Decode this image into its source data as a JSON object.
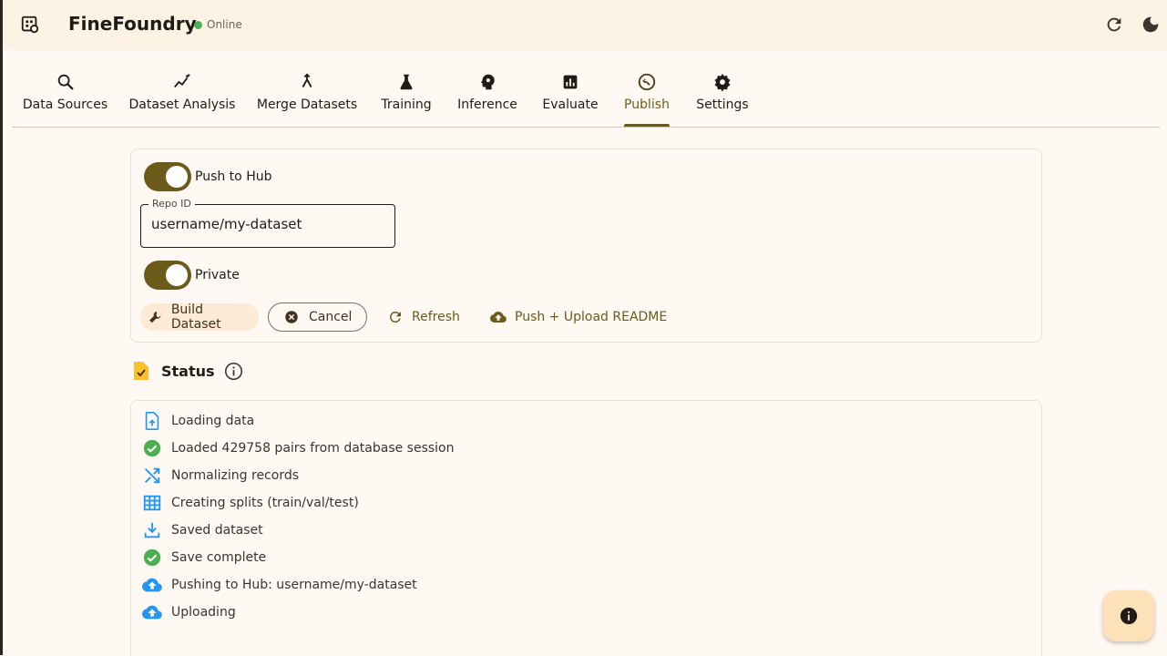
{
  "app": {
    "title": "FineFoundry",
    "status": "Online"
  },
  "tabs": [
    {
      "label": "Data Sources",
      "icon": "search-icon"
    },
    {
      "label": "Dataset Analysis",
      "icon": "insights-icon"
    },
    {
      "label": "Merge Datasets",
      "icon": "merge-icon"
    },
    {
      "label": "Training",
      "icon": "flask-icon"
    },
    {
      "label": "Inference",
      "icon": "psychology-icon"
    },
    {
      "label": "Evaluate",
      "icon": "bar-chart-icon"
    },
    {
      "label": "Publish",
      "icon": "build-circle-icon",
      "active": true
    },
    {
      "label": "Settings",
      "icon": "gear-icon"
    }
  ],
  "publish": {
    "push_to_hub_label": "Push to Hub",
    "push_to_hub_on": true,
    "repo_id_label": "Repo ID",
    "repo_id_value": "username/my-dataset",
    "private_label": "Private",
    "private_on": true,
    "build_label": "Build Dataset",
    "cancel_label": "Cancel",
    "refresh_label": "Refresh",
    "push_upload_label": "Push + Upload README"
  },
  "status": {
    "title": "Status",
    "log": [
      {
        "text": "Loading data",
        "icon": "upload-file-icon"
      },
      {
        "text": "Loaded 429758 pairs from database session",
        "icon": "check-circle-icon"
      },
      {
        "text": "Normalizing records",
        "icon": "shuffle-icon"
      },
      {
        "text": "Creating splits (train/val/test)",
        "icon": "grid-icon"
      },
      {
        "text": "Saved dataset",
        "icon": "download-icon"
      },
      {
        "text": "Save complete",
        "icon": "check-circle-icon"
      },
      {
        "text": "Pushing to Hub: username/my-dataset",
        "icon": "cloud-upload-icon"
      },
      {
        "text": "Uploading",
        "icon": "cloud-upload-icon"
      }
    ]
  },
  "colors": {
    "accent": "#6b5a1a",
    "success": "#4caf50",
    "info": "#2196f3",
    "background": "#fff8f3"
  }
}
